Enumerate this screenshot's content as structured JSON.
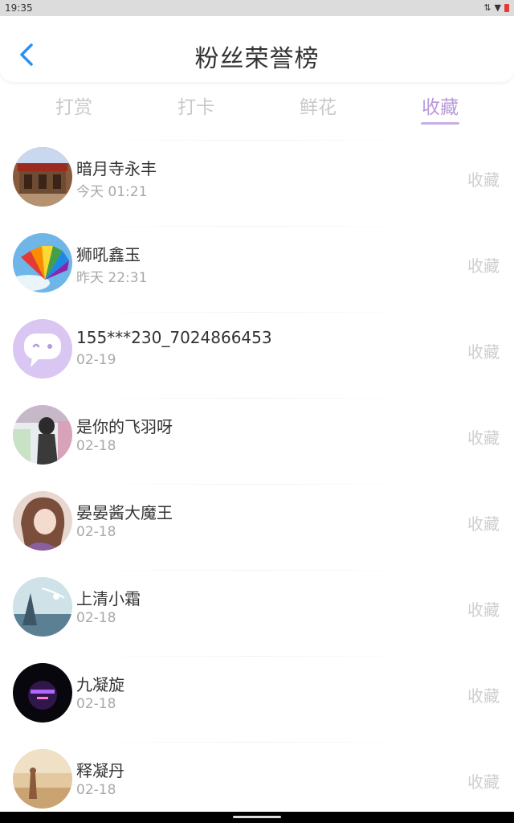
{
  "status": {
    "time": "19:35"
  },
  "header": {
    "title": "粉丝荣誉榜"
  },
  "tabs": [
    {
      "label": "打赏"
    },
    {
      "label": "打卡"
    },
    {
      "label": "鲜花"
    },
    {
      "label": "收藏"
    }
  ],
  "active_tab": 3,
  "colors": {
    "accent": "#b89ad8",
    "back_icon": "#2f8ff0",
    "muted_text": "#a8a8a8"
  },
  "rows": [
    {
      "name": "暗月寺永丰",
      "time": "今天 01:21",
      "action": "收藏"
    },
    {
      "name": "狮吼鑫玉",
      "time": "昨天 22:31",
      "action": "收藏"
    },
    {
      "name": "155***230_7024866453",
      "time": "02-19",
      "action": "收藏"
    },
    {
      "name": "是你的飞羽呀",
      "time": "02-18",
      "action": "收藏"
    },
    {
      "name": "晏晏酱大魔王",
      "time": "02-18",
      "action": "收藏"
    },
    {
      "name": "上清小霜",
      "time": "02-18",
      "action": "收藏"
    },
    {
      "name": "九凝旋",
      "time": "02-18",
      "action": "收藏"
    },
    {
      "name": "释凝丹",
      "time": "02-18",
      "action": "收藏"
    }
  ]
}
